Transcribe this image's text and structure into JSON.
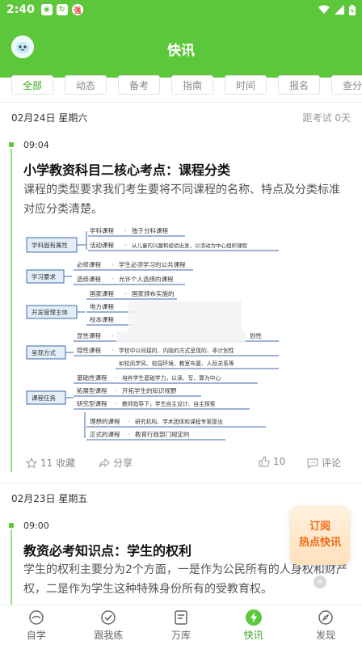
{
  "status_bar": {
    "time": "2:40",
    "app_icons": [
      "wechat-like-icon",
      "lock-app-icon",
      "qiang-app-icon"
    ],
    "right_icons": [
      "wifi-icon",
      "signal-icon",
      "battery-icon"
    ]
  },
  "header": {
    "title": "快讯"
  },
  "tabs": [
    {
      "label": "全部",
      "active": true
    },
    {
      "label": "动态",
      "active": false
    },
    {
      "label": "备考",
      "active": false
    },
    {
      "label": "指南",
      "active": false
    },
    {
      "label": "时间",
      "active": false
    },
    {
      "label": "报名",
      "active": false
    },
    {
      "label": "查分",
      "active": false
    }
  ],
  "feed": {
    "day1": {
      "date": "02月24日  星期六",
      "countdown_prefix": "距考试 ",
      "countdown_value": "0",
      "countdown_unit": "天",
      "article": {
        "time": "09:04",
        "title": "小学教资科目二核心考点：课程分类",
        "summary": "课程的类型要求我们考生要将不同课程的名称、特点及分类标准对应分类清楚。"
      },
      "mindmap": {
        "groups": [
          {
            "label": "学科固有属性",
            "items": [
              [
                "学科课程",
                "独于分科课程"
              ],
              [
                "活动课程",
                "从儿童的兴趣和经验出发，以活动为中心组织课程"
              ]
            ]
          },
          {
            "label": "学习要求",
            "items": [
              [
                "必修课程",
                "学生必须学习的公共课程"
              ],
              [
                "选修课程",
                "允许个人选择的课程"
              ]
            ]
          },
          {
            "label": "开发管理主体",
            "items": [
              [
                "国家课程",
                "国家颁布实施的"
              ],
              [
                "地方课程",
                ""
              ],
              [
                "校本课程",
                ""
              ]
            ]
          },
          {
            "label": "呈现方式",
            "items": [
              [
                "显性课程",
                "划性"
              ],
              [
                "隐性课程",
                "学校中以间接的、内隐的方式呈现的、非计划性"
              ],
              [
                "",
                "如校风学风、校园环境、教室布置、人际关系等"
              ]
            ]
          },
          {
            "label": "课程任务",
            "items": [
              [
                "基础性课程",
                "培养学生基础学力，以读、写、算为中心"
              ],
              [
                "拓展型课程",
                "开拓学生的知识视野"
              ],
              [
                "研究型课程",
                "教师指导下，学生自主设计、自主探索"
              ]
            ]
          },
          {
            "label": "",
            "items": [
              [
                "理想的课程",
                "研究机构、学术团体和课程专家提出"
              ],
              [
                "正式的课程",
                "教育行政部门规定的"
              ]
            ]
          }
        ]
      },
      "actions": {
        "favorite_count": "11",
        "favorite_label": "收藏",
        "share_label": "分享",
        "like_count": "10",
        "comment_label": "评论"
      }
    },
    "day2": {
      "date": "02月23日  星期五",
      "article": {
        "time": "09:00",
        "title": "教资必考知识点：学生的权利",
        "summary": "学生的权利主要分为2个方面，一是作为公民所有的人身权和财产权，二是作为学生这种特殊身份所有的受教育权。"
      }
    }
  },
  "promo": {
    "line1": "订阅",
    "line2": "热点快讯"
  },
  "bottom_nav": [
    {
      "label": "自学",
      "icon": "self-study-icon",
      "active": false
    },
    {
      "label": "跟我练",
      "icon": "check-circle-icon",
      "active": false
    },
    {
      "label": "万库",
      "icon": "library-icon",
      "active": false
    },
    {
      "label": "快讯",
      "icon": "bolt-icon",
      "active": true
    },
    {
      "label": "发现",
      "icon": "compass-icon",
      "active": false
    }
  ],
  "colors": {
    "brand_green": "#5cc73b",
    "accent_orange": "#f06a12",
    "mindmap_blue": "#3d6aa8"
  }
}
